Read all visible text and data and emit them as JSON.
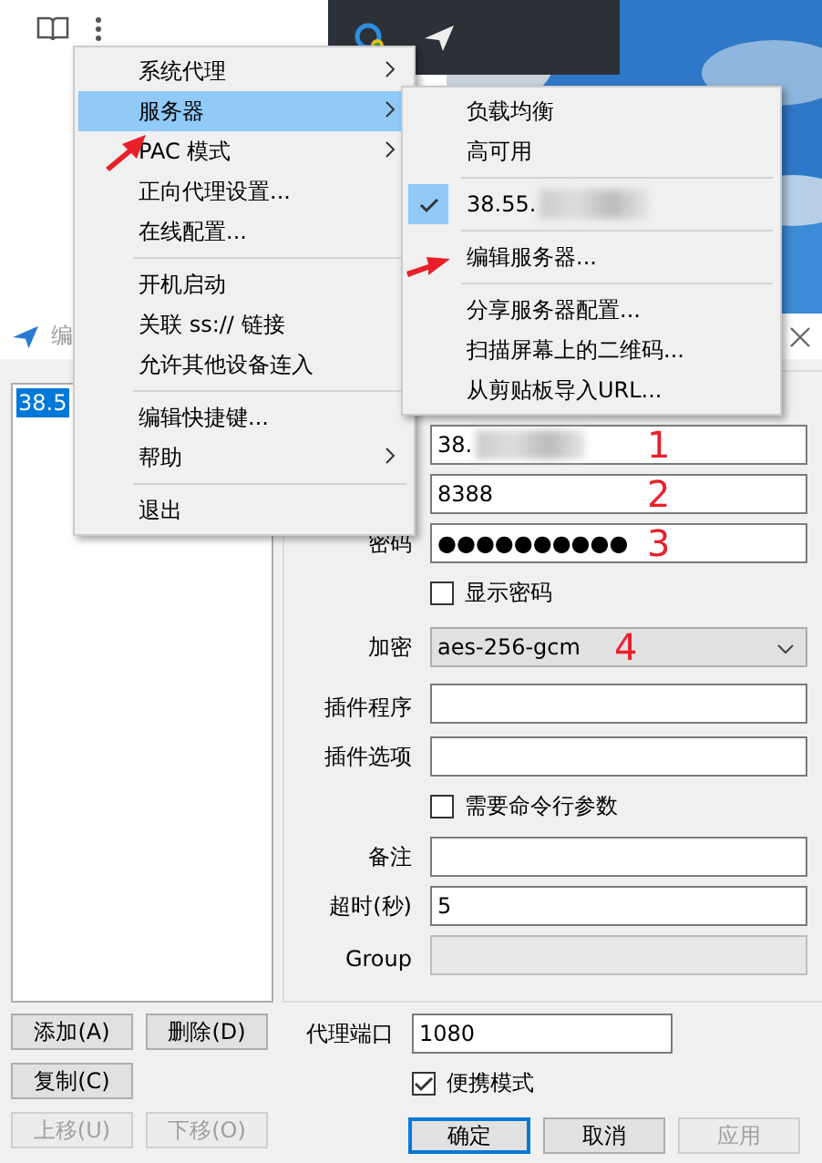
{
  "menu": {
    "items": [
      {
        "kind": "item",
        "label": "系统代理",
        "submenu": true,
        "selected": false
      },
      {
        "kind": "item",
        "label": "服务器",
        "submenu": true,
        "selected": true
      },
      {
        "kind": "item",
        "label": "PAC 模式",
        "submenu": true,
        "selected": false
      },
      {
        "kind": "item",
        "label": "正向代理设置...",
        "submenu": false,
        "selected": false
      },
      {
        "kind": "item",
        "label": "在线配置...",
        "submenu": false,
        "selected": false
      },
      {
        "kind": "separator"
      },
      {
        "kind": "item",
        "label": "开机启动",
        "submenu": false,
        "selected": false
      },
      {
        "kind": "item",
        "label": "关联 ss:// 链接",
        "submenu": false,
        "selected": false
      },
      {
        "kind": "item",
        "label": "允许其他设备连入",
        "submenu": false,
        "selected": false
      },
      {
        "kind": "separator"
      },
      {
        "kind": "item",
        "label": "编辑快捷键...",
        "submenu": false,
        "selected": false
      },
      {
        "kind": "item",
        "label": "帮助",
        "submenu": true,
        "selected": false
      },
      {
        "kind": "separator"
      },
      {
        "kind": "item",
        "label": "退出",
        "submenu": false,
        "selected": false
      }
    ]
  },
  "submenu": {
    "items": [
      {
        "kind": "item",
        "label": "负载均衡",
        "checked": false,
        "blurred": false
      },
      {
        "kind": "item",
        "label": "高可用",
        "checked": false,
        "blurred": false
      },
      {
        "kind": "separator"
      },
      {
        "kind": "item",
        "label": "38.55.",
        "checked": true,
        "blurred": true
      },
      {
        "kind": "separator"
      },
      {
        "kind": "item",
        "label": "编辑服务器...",
        "checked": false,
        "blurred": false
      },
      {
        "kind": "separator"
      },
      {
        "kind": "item",
        "label": "分享服务器配置...",
        "checked": false,
        "blurred": false
      },
      {
        "kind": "item",
        "label": "扫描屏幕上的二维码...",
        "checked": false,
        "blurred": false
      },
      {
        "kind": "item",
        "label": "从剪贴板导入URL...",
        "checked": false,
        "blurred": false
      }
    ]
  },
  "dialog": {
    "title": "编",
    "servers": [
      {
        "text": "38.5",
        "selected": true
      }
    ],
    "fields": [
      {
        "kind": "input",
        "value": "38.",
        "blurred": true,
        "annotation": "1",
        "disabled": false
      },
      {
        "kind": "input",
        "value": "8388",
        "blurred": false,
        "annotation": "2",
        "disabled": false
      },
      {
        "kind": "input",
        "label": "密码",
        "value": "●●●●●●●●●●",
        "blurred": false,
        "annotation": "3",
        "disabled": false
      },
      {
        "kind": "checkbox",
        "label": "显示密码",
        "checked": false
      },
      {
        "kind": "select",
        "label": "加密",
        "value": "aes-256-gcm",
        "annotation": "4"
      },
      {
        "kind": "input",
        "label": "插件程序",
        "blurred": false,
        "disabled": false
      },
      {
        "kind": "input",
        "label": "插件选项",
        "blurred": false,
        "disabled": false
      },
      {
        "kind": "checkbox",
        "label": "需要命令行参数",
        "checked": false
      },
      {
        "kind": "input",
        "label": "备注",
        "blurred": false,
        "disabled": false
      },
      {
        "kind": "input",
        "label": "超时(秒)",
        "value": "5",
        "blurred": false,
        "disabled": false
      },
      {
        "kind": "input",
        "label": "Group",
        "blurred": false,
        "disabled": true
      }
    ],
    "list_buttons": [
      {
        "label": "添加(A)",
        "disabled": false
      },
      {
        "label": "删除(D)",
        "disabled": false
      },
      {
        "label": "复制(C)",
        "disabled": false
      },
      {
        "label": "上移(U)",
        "disabled": true
      },
      {
        "label": "下移(O)",
        "disabled": true
      }
    ],
    "proxy_port": {
      "label": "代理端口",
      "value": "1080"
    },
    "portable": {
      "label": "便携模式",
      "checked": true
    },
    "actions": [
      {
        "label": "确定",
        "default": true,
        "disabled": false
      },
      {
        "label": "取消",
        "default": false,
        "disabled": false
      },
      {
        "label": "应用",
        "default": false,
        "disabled": true
      }
    ]
  }
}
